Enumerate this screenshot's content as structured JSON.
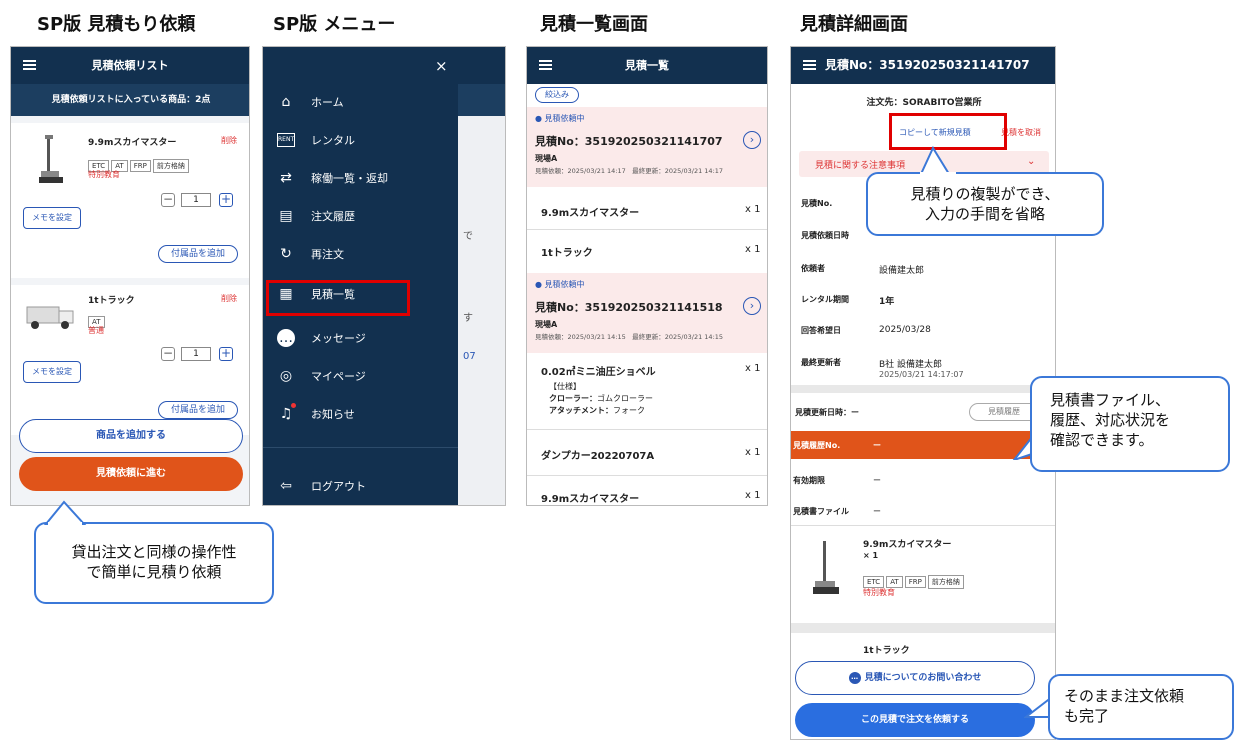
{
  "sections": {
    "s1": "SP版 見積もり依頼",
    "s2": "SP版 メニュー",
    "s3": "見積一覧画面",
    "s4": "見積詳細画面"
  },
  "p1": {
    "title": "見積依頼リスト",
    "banner": "見積依頼リストに入っている商品：2点",
    "items": [
      {
        "name": "9.9mスカイマスター",
        "delete": "削除",
        "tags": [
          "ETC",
          "AT",
          "FRP",
          "前方格納"
        ],
        "note": "特別教育",
        "qty": "1",
        "memo": "メモを設定",
        "addon": "付属品を追加"
      },
      {
        "name": "1tトラック",
        "delete": "削除",
        "tags": [
          "AT"
        ],
        "note": "普通",
        "qty": "1",
        "memo": "メモを設定",
        "addon": "付属品を追加"
      }
    ],
    "add_item": "商品を追加する",
    "proceed": "見積依頼に進む"
  },
  "p2": {
    "close": "×",
    "menu": [
      {
        "icon": "⌂",
        "label": "ホーム"
      },
      {
        "icon": "RENT",
        "label": "レンタル"
      },
      {
        "icon": "⇄",
        "label": "稼働一覧・返却"
      },
      {
        "icon": "▤",
        "label": "注文履歴"
      },
      {
        "icon": "↻",
        "label": "再注文"
      },
      {
        "icon": "▦",
        "label": "見積一覧"
      },
      {
        "icon": "…",
        "label": "メッセージ"
      },
      {
        "icon": "◎",
        "label": "マイページ"
      },
      {
        "icon": "♫",
        "label": "お知らせ"
      },
      {
        "icon": "⇦",
        "label": "ログアウト"
      }
    ],
    "bg_text": [
      "で",
      "す",
      "07"
    ]
  },
  "p3": {
    "title": "見積一覧",
    "filter": "絞込み",
    "estimates": [
      {
        "status": "● 見積依頼中",
        "no": "見積No：351920250321141707",
        "site": "現場A",
        "dates": "見積依頼：2025/03/21 14:17　最終更新：2025/03/21 14:17",
        "lines": [
          {
            "name": "9.9mスカイマスター",
            "qty": "x 1"
          },
          {
            "name": "1tトラック",
            "qty": "x 1"
          }
        ]
      },
      {
        "status": "● 見積依頼中",
        "no": "見積No：351920250321141518",
        "site": "現場A",
        "dates": "見積依頼：2025/03/21 14:15　最終更新：2025/03/21 14:15",
        "lines": [
          {
            "name": "0.02㎥ミニ油圧ショベル",
            "qty": "x 1"
          },
          {
            "name": "ダンプカー20220707A",
            "qty": "x 1"
          },
          {
            "name": "9.9mスカイマスター",
            "qty": "x 1"
          }
        ]
      }
    ],
    "spec_head": "【仕様】",
    "spec1_k": "クローラー：",
    "spec1_v": "ゴムクローラー",
    "spec2_k": "アタッチメント：",
    "spec2_v": "フォーク"
  },
  "p4": {
    "title": "見積No：351920250321141707",
    "customer": "注文先：SORABITO営業所",
    "copy": "コピーして新規見積",
    "cancel": "見積を取消",
    "notice": "見積に関する注意事項",
    "rows": [
      {
        "k": "見積No.",
        "v": ""
      },
      {
        "k": "見積依頼日時",
        "v": ""
      },
      {
        "k": "依頼者",
        "v": "設備建太郎"
      },
      {
        "k": "レンタル期間",
        "v": "1年"
      },
      {
        "k": "回答希望日",
        "v": "2025/03/28"
      },
      {
        "k": "最終更新者",
        "v": "B社 設備建太郎"
      }
    ],
    "updated_time": "2025/03/21 14:17:07",
    "history_time": "見積更新日時：ー",
    "history_btn": "見積履歴",
    "orange_k": "見積履歴No.",
    "orange_v": "ー",
    "valid_k": "有効期限",
    "valid_v": "ー",
    "file_k": "見積書ファイル",
    "file_v": "ー",
    "item_name": "9.9mスカイマスター",
    "item_qty": "× 1",
    "item_tags": [
      "ETC",
      "AT",
      "FRP",
      "前方格納"
    ],
    "item_note": "特別教育",
    "item2_name": "1tトラック",
    "inquiry": "見積についてのお問い合わせ",
    "order": "この見積で注文を依頼する"
  },
  "callouts": {
    "c1": "貸出注文と同様の操作性で簡単に見積り依頼",
    "c1a": "貸出注文と同様の操作性",
    "c1b": "で簡単に見積り依頼",
    "c2a": "見積りの複製ができ、",
    "c2b": "入力の手間を省略",
    "c3a": "見積書ファイル、",
    "c3b": "履歴、対応状況を",
    "c3c": "確認できます。",
    "c4a": "そのまま注文依頼",
    "c4b": "も完了"
  },
  "colors": {
    "navy": "#12304f",
    "orange": "#e0541a",
    "blue": "#2a57b5",
    "red": "#e00000"
  }
}
